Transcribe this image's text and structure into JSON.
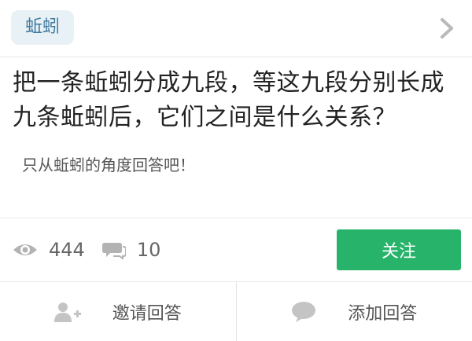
{
  "topic": {
    "tag_label": "蚯蚓"
  },
  "question": {
    "title": "把一条蚯蚓分成九段，等这九段分别长成九条蚯蚓后，它们之间是什么关系？",
    "description": "只从蚯蚓的角度回答吧！"
  },
  "stats": {
    "views": "444",
    "comments": "10"
  },
  "follow_button": {
    "label": "关注"
  },
  "actions": [
    {
      "label": "邀请回答",
      "icon": "add-user-icon"
    },
    {
      "label": "添加回答",
      "icon": "speech-bubble-icon"
    }
  ],
  "colors": {
    "accent_green": "#27b36a",
    "tag_bg": "#e8f1f5",
    "tag_text": "#3f7aa0"
  }
}
